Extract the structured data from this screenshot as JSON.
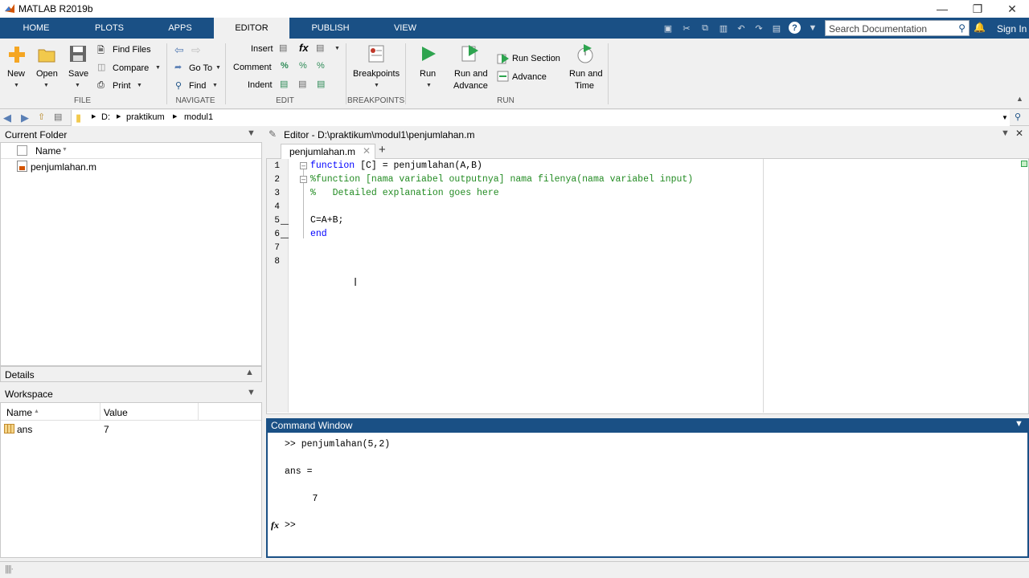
{
  "window": {
    "title": "MATLAB R2019b"
  },
  "tabs": [
    {
      "label": "HOME"
    },
    {
      "label": "PLOTS"
    },
    {
      "label": "APPS"
    },
    {
      "label": "EDITOR"
    },
    {
      "label": "PUBLISH"
    },
    {
      "label": "VIEW"
    }
  ],
  "search": {
    "placeholder": "Search Documentation"
  },
  "signin": "Sign In",
  "ribbon": {
    "file": {
      "new": "New",
      "open": "Open",
      "save": "Save",
      "find_files": "Find Files",
      "compare": "Compare",
      "print": "Print",
      "group": "FILE"
    },
    "navigate": {
      "go_to": "Go To",
      "find": "Find",
      "group": "NAVIGATE"
    },
    "edit": {
      "insert": "Insert",
      "comment": "Comment",
      "indent": "Indent",
      "group": "EDIT"
    },
    "breakpoints": {
      "label": "Breakpoints",
      "group": "BREAKPOINTS"
    },
    "run": {
      "run": "Run",
      "run_advance": [
        "Run and",
        "Advance"
      ],
      "run_section": "Run Section",
      "advance": "Advance",
      "run_time": [
        "Run and",
        "Time"
      ],
      "group": "RUN"
    }
  },
  "path": {
    "drive": "D:",
    "folder1": "praktikum",
    "folder2": "modul1"
  },
  "current_folder": {
    "title": "Current Folder",
    "col_name": "Name",
    "files": [
      "penjumlahan.m"
    ]
  },
  "details": {
    "title": "Details"
  },
  "workspace": {
    "title": "Workspace",
    "col_name": "Name",
    "col_value": "Value",
    "vars": [
      {
        "name": "ans",
        "value": "7"
      }
    ]
  },
  "editor": {
    "title": "Editor - D:\\praktikum\\modul1\\penjumlahan.m",
    "tab": "penjumlahan.m",
    "line_numbers": [
      "1",
      "2",
      "3",
      "4",
      "5",
      "6",
      "7",
      "8"
    ],
    "lines": [
      {
        "kw": "function",
        "rest": " [C] = penjumlahan(A,B)"
      },
      {
        "comment": "%function [nama variabel outputnya] nama filenya(nama variabel input)"
      },
      {
        "comment": "%   Detailed explanation goes here"
      },
      {
        "text": ""
      },
      {
        "text": "C=A+B;"
      },
      {
        "kw": "end",
        "rest": ""
      },
      {
        "text": ""
      },
      {
        "text": ""
      }
    ]
  },
  "command_window": {
    "title": "Command Window",
    "lines": [
      ">> penjumlahan(5,2)",
      "ans =",
      "     7"
    ],
    "prompt": ">>",
    "fx": "fx"
  }
}
